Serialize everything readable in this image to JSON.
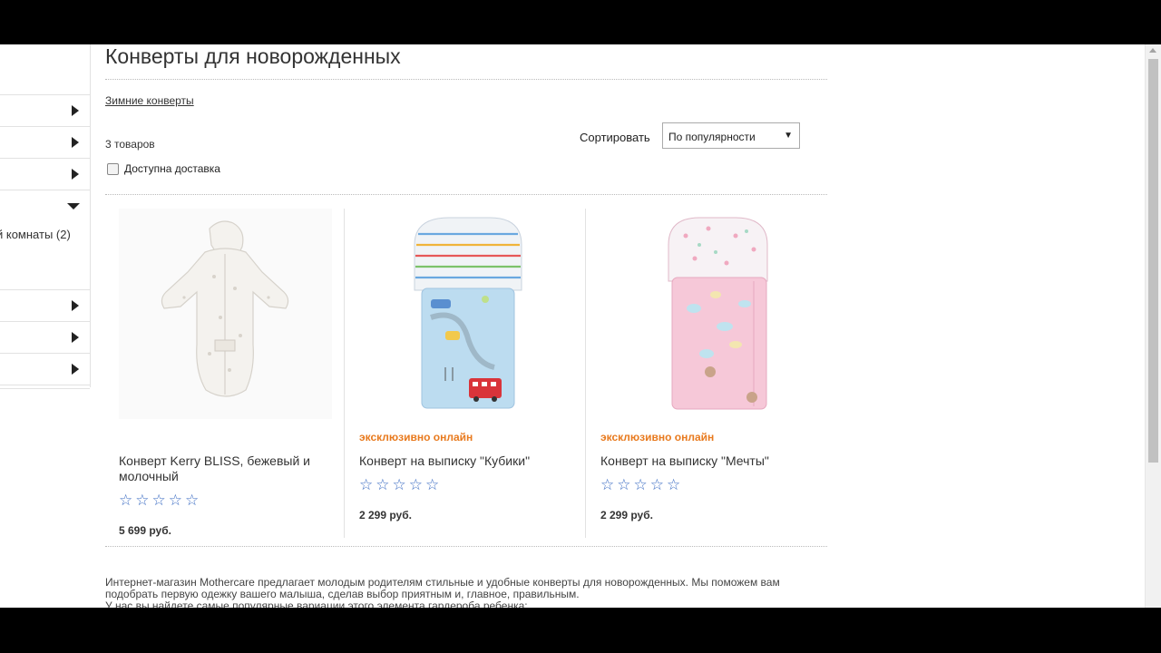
{
  "page": {
    "title": "Конверты для новорожденных",
    "subcategory_link": "Зимние конверты",
    "item_count": "3 товаров",
    "filter_delivery_label": "Доступна доставка",
    "sort_label": "Сортировать",
    "sort_value": "По популярности",
    "description_line1": "Интернет-магазин Mothercare предлагает молодым родителям стильные и удобные конверты для новорожденных. Мы поможем вам",
    "description_line2": "подобрать первую одежку вашего малыша, сделав выбор приятным и, главное, правильным.",
    "description_line3": "У нас вы найдете самые популярные вариации этого элемента гардероба ребенка:"
  },
  "sidebar": {
    "sub_item": "й комнаты (2)"
  },
  "products": [
    {
      "name": "Конверт Kerry BLISS, бежевый и молочный",
      "tag": "",
      "price": "5 699 руб.",
      "stars": "☆☆☆☆☆"
    },
    {
      "name": "Конверт на выписку \"Кубики\"",
      "tag": "эксклюзивно онлайн",
      "price": "2 299 руб.",
      "stars": "☆☆☆☆☆"
    },
    {
      "name": "Конверт на выписку \"Мечты\"",
      "tag": "эксклюзивно онлайн",
      "price": "2 299 руб.",
      "stars": "☆☆☆☆☆"
    }
  ],
  "colors": {
    "accent_orange": "#e87a1e",
    "star_blue": "#3f6fc4"
  },
  "icons": {
    "sidebar_expand": "triangle-right-icon",
    "sidebar_collapse": "triangle-down-icon",
    "select_caret": "caret-down-icon"
  }
}
